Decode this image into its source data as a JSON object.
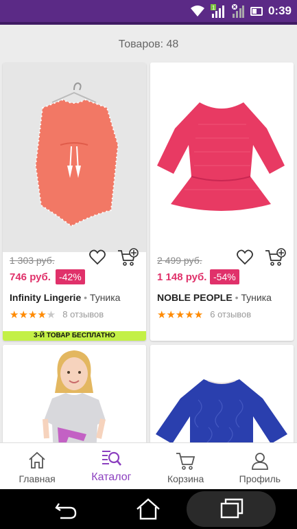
{
  "status_bar": {
    "time": "0:39",
    "signal_badge": "1",
    "icons": [
      "wifi-icon",
      "signal-icon",
      "no-sim-signal-icon",
      "battery-icon"
    ]
  },
  "catalog": {
    "count_text": "Товаров: 48"
  },
  "products": [
    {
      "old_price": "1 303 руб.",
      "new_price": "746 руб.",
      "discount": "-42%",
      "brand": "Infinity Lingerie",
      "separator": "•",
      "type": "Туника",
      "rating": 4,
      "reviews": "8 отзывов",
      "promo": "3-Й ТОВАР БЕСПЛАТНО",
      "image": "coral-tunic-on-hanger"
    },
    {
      "old_price": "2 499 руб.",
      "new_price": "1 148 руб.",
      "discount": "-54%",
      "brand": "NOBLE PEOPLE",
      "separator": "•",
      "type": "Туника",
      "rating": 5,
      "reviews": "6 отзывов",
      "image": "pink-lace-dress-bell-sleeves"
    },
    {
      "image": "girl-in-grey-tunic"
    },
    {
      "image": "blue-lace-dress-bell-sleeves"
    }
  ],
  "tab_bar": {
    "active": "catalog",
    "items": [
      {
        "key": "home",
        "label": "Главная",
        "icon": "home-icon"
      },
      {
        "key": "catalog",
        "label": "Каталог",
        "icon": "catalog-search-icon"
      },
      {
        "key": "cart",
        "label": "Корзина",
        "icon": "cart-icon"
      },
      {
        "key": "profile",
        "label": "Профиль",
        "icon": "profile-icon"
      }
    ]
  },
  "colors": {
    "brand": "#5b2a86",
    "accent": "#8b3fbf",
    "price": "#e0316a",
    "promo": "#c3f046",
    "stars": "#ff8a00"
  }
}
